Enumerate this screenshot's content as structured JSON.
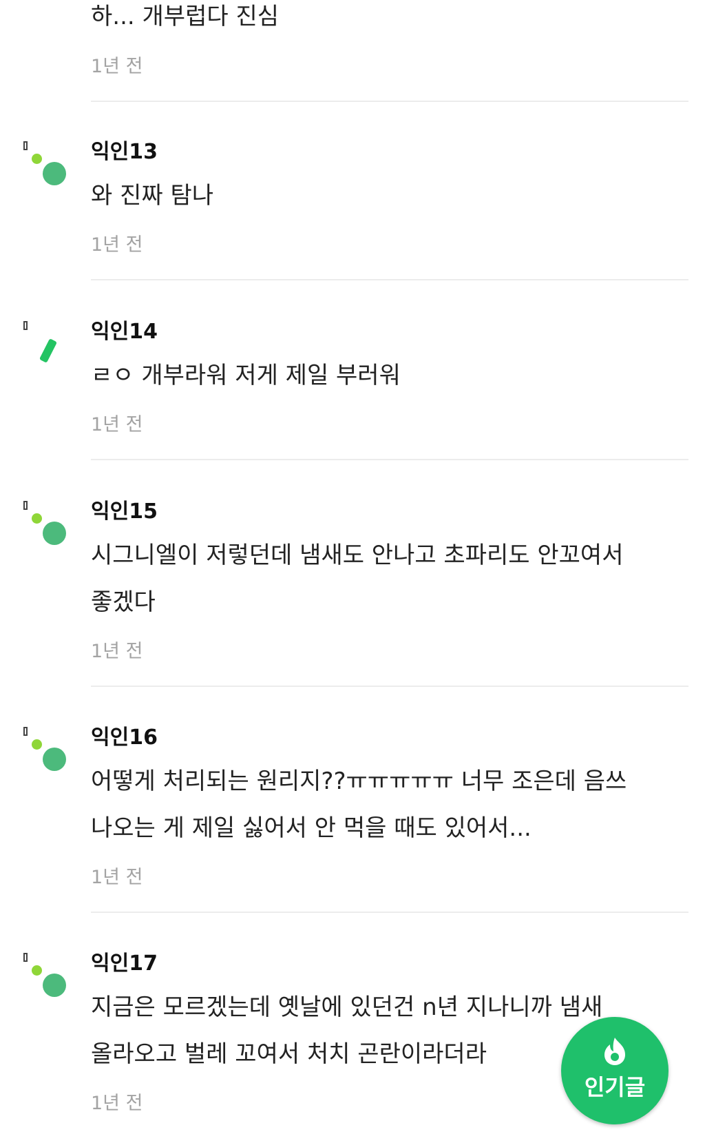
{
  "comments": [
    {
      "author": "",
      "text": "하... 개부럽다 진심",
      "time": "1년 전"
    },
    {
      "author": "익인13",
      "text": "와 진짜 탐나",
      "time": "1년 전"
    },
    {
      "author": "익인14",
      "text": "ㄹㅇ 개부라워 저게 제일 부러워",
      "time": "1년 전"
    },
    {
      "author": "익인15",
      "text": "시그니엘이 저렇던데 냄새도 안나고 초파리도 안꼬여서 좋겠다",
      "time": "1년 전"
    },
    {
      "author": "익인16",
      "text": "어떻게 처리되는 원리지??ㅠㅠㅠㅠㅠ 너무 조은데 음쓰 나오는 게 제일 싫어서 안 먹을 때도 있어서...",
      "time": "1년 전"
    },
    {
      "author": "익인17",
      "text": "지금은 모르겠는데 옛날에 있던건 n년 지나니까 냄새 올라오고 벌레 꼬여서 처치 곤란이라더라",
      "time": "1년 전"
    }
  ],
  "fab": {
    "label": "인기글",
    "icon": "flame-icon"
  },
  "colors": {
    "accent": "#1fc06b",
    "avatar_green": "#4cba7c",
    "avatar_lime": "#8fd638",
    "time_gray": "#a3a3a3",
    "divider": "#ececec"
  }
}
